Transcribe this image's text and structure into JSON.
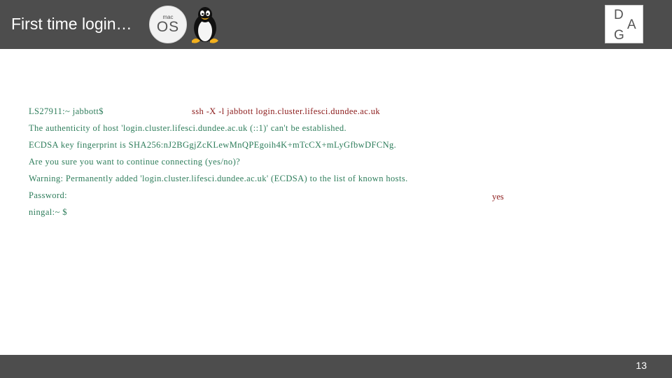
{
  "header": {
    "title": "First time login…",
    "macos_logo": {
      "small": "mac",
      "big": "OS",
      "icon": "macos-icon"
    },
    "linux_logo": {
      "icon": "tux-penguin-icon"
    },
    "brand_logo": {
      "letters": [
        "D",
        "A",
        "G"
      ],
      "icon": "dga-logo"
    }
  },
  "terminal": {
    "prompt": "LS27911:~ jabbott$",
    "command": "ssh -X -l jabbott login.cluster.lifesci.dundee.ac.uk",
    "lines": [
      "The authenticity of host 'login.cluster.lifesci.dundee.ac.uk (::1)' can't be established.",
      "ECDSA key fingerprint is SHA256:nJ2BGgjZcKLewMnQPEgoih4K+mTcCX+mLyGfbwDFCNg.",
      "Are you sure you want to continue connecting (yes/no)?",
      "Warning: Permanently added 'login.cluster.lifesci.dundee.ac.uk' (ECDSA) to the list of known hosts.",
      "Password:",
      "ningal:~ $"
    ],
    "response": "yes",
    "colors": {
      "output": "#2e7d5b",
      "user_input": "#8b1a1a"
    }
  },
  "footer": {
    "page_number": "13"
  }
}
